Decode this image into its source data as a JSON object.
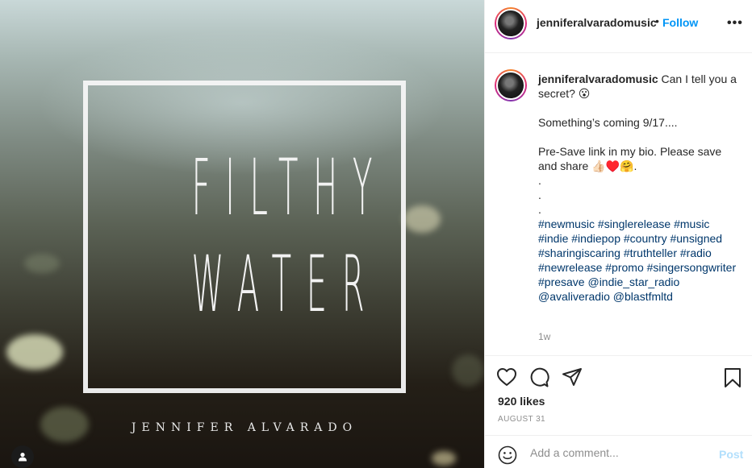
{
  "post": {
    "media": {
      "title_line1": "FILTHY",
      "title_line2": "WATER",
      "artist": "JENNIFER ALVARADO",
      "icon": "user-icon"
    },
    "header": {
      "username": "jenniferalvaradomusic",
      "separator": "•",
      "follow_label": "Follow",
      "more_label": "•••"
    },
    "caption": {
      "username": "jenniferalvaradomusic",
      "line1": "Can I tell you a secret? 😮",
      "line2": "Something’s coming 9/17....",
      "line3": "Pre-Save link in my bio. Please save and share 👍🏻♥️🤗.",
      "dot1": ".",
      "dot2": ".",
      "dot3": ".",
      "hashtags": "#newmusic #singlerelease #music #indie #indiepop #country #unsigned #sharingiscaring #truthteller #radio #newrelease #promo #singersongwriter #presave @indie_star_radio @avaliveradio @blastfmltd",
      "time_ago": "1w"
    },
    "actions": {
      "likes": "920 likes",
      "date": "AUGUST 31",
      "icons": [
        "heart-icon",
        "comment-icon",
        "share-icon",
        "bookmark-icon"
      ]
    },
    "comment": {
      "placeholder": "Add a comment...",
      "post_label": "Post",
      "emoji_icon": "smiley-icon"
    }
  },
  "colors": {
    "link_blue": "#0095f6",
    "hashtag_blue": "#00376b",
    "post_disabled": "#b2dffc",
    "muted": "#8e8e8e",
    "text": "#262626"
  }
}
